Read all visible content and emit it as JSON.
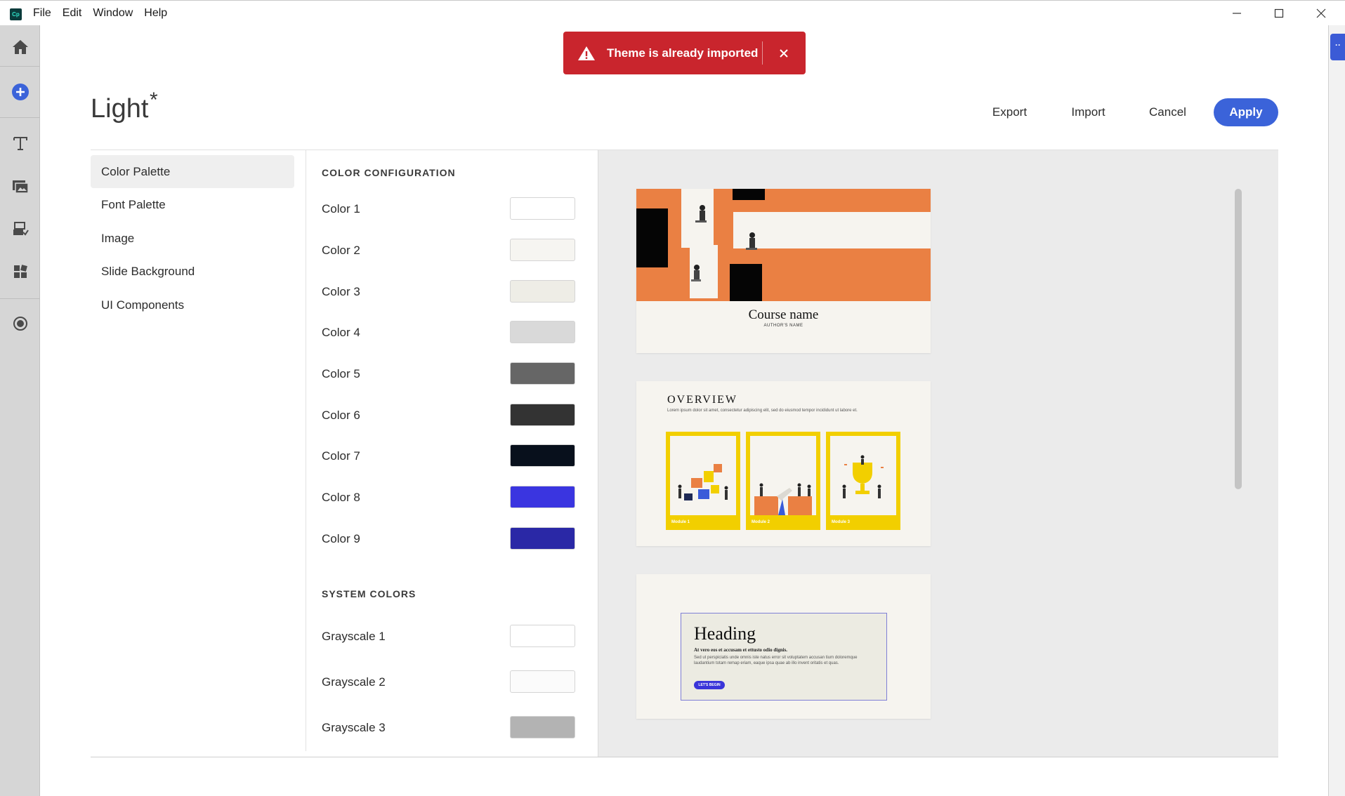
{
  "window": {
    "app_icon_text": "Cp",
    "menu": [
      "File",
      "Edit",
      "Window",
      "Help"
    ]
  },
  "toast": {
    "message": "Theme is already imported"
  },
  "header": {
    "title": "Light",
    "modified_marker": "*",
    "buttons": {
      "export": "Export",
      "import": "Import",
      "cancel": "Cancel",
      "apply": "Apply"
    }
  },
  "nav": {
    "items": [
      "Color Palette",
      "Font Palette",
      "Image",
      "Slide Background",
      "UI Components"
    ],
    "active": "Color Palette"
  },
  "color_config": {
    "heading": "COLOR CONFIGURATION",
    "colors": [
      {
        "label": "Color 1",
        "value": "#ffffff"
      },
      {
        "label": "Color 2",
        "value": "#f6f5f1"
      },
      {
        "label": "Color 3",
        "value": "#eeede6"
      },
      {
        "label": "Color 4",
        "value": "#d9d9d9"
      },
      {
        "label": "Color 5",
        "value": "#666666"
      },
      {
        "label": "Color 6",
        "value": "#333333"
      },
      {
        "label": "Color 7",
        "value": "#08101c"
      },
      {
        "label": "Color 8",
        "value": "#3a35e0"
      },
      {
        "label": "Color 9",
        "value": "#2a28a6"
      }
    ]
  },
  "system_colors": {
    "heading": "SYSTEM COLORS",
    "colors": [
      {
        "label": "Grayscale 1",
        "value": "#ffffff"
      },
      {
        "label": "Grayscale 2",
        "value": "#fbfbfb"
      },
      {
        "label": "Grayscale 3",
        "value": "#b3b3b3"
      }
    ]
  },
  "preview": {
    "card1": {
      "course_name": "Course name",
      "author": "AUTHOR'S NAME"
    },
    "card2": {
      "title": "OVERVIEW",
      "subtitle": "Lorem ipsum dolor sit amet, consectetur adipiscing elit, sed do eiusmod tempor incididunt ut labore et.",
      "modules": [
        "Module 1",
        "Module 2",
        "Module 3"
      ]
    },
    "card3": {
      "heading": "Heading",
      "subheading": "At vero eos et accusam et ettusto odio dignis.",
      "body": "Sed ut perspiciatis unde omnis iste natus error sit voluptatem accusan tium doloremque laudantium totam remap eriam, eaque ipsa quae ab illo invent oritatis et quas.",
      "button": "LET'S BEGIN"
    }
  }
}
